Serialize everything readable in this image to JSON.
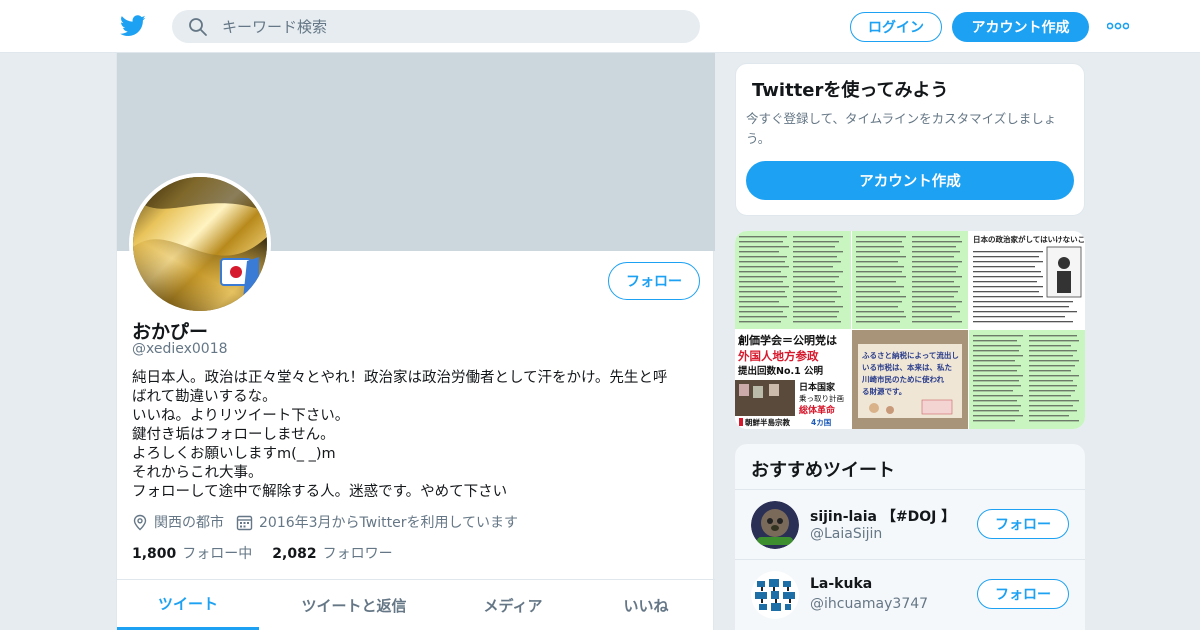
{
  "header": {
    "search_placeholder": "キーワード検索",
    "login_label": "ログイン",
    "signup_label": "アカウント作成",
    "brand_color": "#1da1f2",
    "icons": [
      "twitter-logo-icon",
      "search-icon",
      "more-icon"
    ]
  },
  "profile": {
    "name": "おかぴー",
    "handle": "@xediex0018",
    "follow_label": "フォロー",
    "bio_lines": [
      "純日本人。政治は正々堂々とやれ！政治家は政治労働者として汗をかけ。先生と呼",
      "ばれて勘違いするな。",
      "いいね。よりリツイート下さい。",
      "鍵付き垢はフォローしません。",
      "よろしくお願いしますm(_ _)m",
      "それからこれ大事。",
      "フォローして途中で解除する人。迷惑です。やめて下さい"
    ],
    "location": "関西の都市",
    "joined": "2016年3月からTwitterを利用しています",
    "following_count": "1,800",
    "following_label": "フォロー中",
    "followers_count": "2,082",
    "followers_label": "フォロワー",
    "tabs": [
      {
        "label": "ツイート",
        "active": true
      },
      {
        "label": "ツイートと返信",
        "active": false
      },
      {
        "label": "メディア",
        "active": false
      },
      {
        "label": "いいね",
        "active": false
      }
    ]
  },
  "signup_card": {
    "title": "Twitterを使ってみよう",
    "description": "今すぐ登録して、タイムラインをカスタマイズしましょう。",
    "button_label": "アカウント作成"
  },
  "media_grid": {
    "captions": {
      "p4_line1": "創価学会＝公明党は",
      "p4_line2": "外国人地方参政",
      "p4_line3": "提出回数No.1 公明",
      "p4_line4": "日本国家",
      "p4_line5": "乗っ取り計画",
      "p4_line6": "総体革命",
      "p4_line7": "朝鮮半島宗教",
      "p4_line8": "4カ国",
      "p5_line1": "ふるさと納税によって流出し",
      "p5_line2": "いる市税は、本来は、私た",
      "p5_line3": "川崎市民のために使われ",
      "p5_line4": "る財源です。",
      "p3_title": "日本の政治家がしてはいけないこと"
    }
  },
  "recommended": {
    "title": "おすすめツイート",
    "items": [
      {
        "name": "sijin-laia 【#DOJ 】",
        "handle": "@LaiaSijin",
        "follow_label": "フォロー"
      },
      {
        "name": "La-kuka",
        "handle": "@ihcuamay3747",
        "follow_label": "フォロー"
      }
    ]
  }
}
